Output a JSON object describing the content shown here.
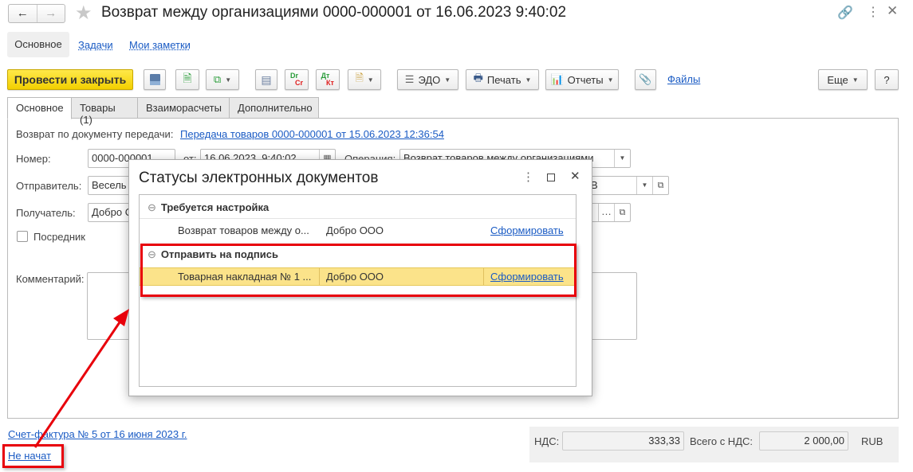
{
  "window": {
    "title": "Возврат между организациями 0000-000001 от 16.06.2023 9:40:02",
    "back_icon": "arrow-left",
    "forward_icon": "arrow-right",
    "star_icon": "star",
    "link_icon": "link",
    "more_icon": "more-vertical",
    "close_icon": "close"
  },
  "nav": {
    "items": [
      {
        "label": "Основное"
      },
      {
        "label": "Задачи"
      },
      {
        "label": "Мои заметки"
      }
    ]
  },
  "toolbar": {
    "post_close": "Провести и закрыть",
    "edo": "ЭДО",
    "print": "Печать",
    "reports": "Отчеты",
    "files": "Файлы",
    "more": "Еще",
    "help": "?",
    "dr": "Dr",
    "cr": "Cr",
    "dt": "Дт",
    "kt": "Кт"
  },
  "tabs": [
    {
      "label": "Основное"
    },
    {
      "label": "Товары (1)"
    },
    {
      "label": "Взаиморасчеты"
    },
    {
      "label": "Дополнительно"
    }
  ],
  "form": {
    "basis_label": "Возврат по документу передачи:",
    "basis_link": "Передача товаров 0000-000001 от 15.06.2023 12:36:54",
    "number_label": "Номер:",
    "number": "0000-000001",
    "date_label": "от:",
    "date": "16.06.2023  9:40:02",
    "operation_label": "Операция:",
    "operation": "Возврат товаров между организациями",
    "sender_label": "Отправитель:",
    "sender": "Весель",
    "sender_right": "В",
    "receiver_label": "Получатель:",
    "receiver": "Добро О",
    "intermediary_label": "Посредник",
    "intermediary_checked": false,
    "comment_label": "Комментарий:",
    "comment": ""
  },
  "dialog": {
    "title": "Статусы электронных документов",
    "groups": [
      {
        "name": "Требуется настройка",
        "rows": [
          {
            "doc": "Возврат товаров между о...",
            "org": "Добро ООО",
            "action": "Сформировать",
            "selected": false
          }
        ]
      },
      {
        "name": "Отправить на подпись",
        "rows": [
          {
            "doc": "Товарная накладная № 1 ...",
            "org": "Добро ООО",
            "action": "Сформировать",
            "selected": true
          }
        ]
      }
    ]
  },
  "footer": {
    "invoice_link": "Счет-фактура № 5 от 16 июня 2023 г.",
    "edo_status": "Не начат",
    "vat_label": "НДС:",
    "vat": "333,33",
    "total_label": "Всего с НДС:",
    "total": "2 000,00",
    "currency": "RUB"
  },
  "colors": {
    "accent_yellow": "#f5d800",
    "link": "#1a5bc4",
    "highlight": "#fbe38a",
    "annotation_red": "#e8000b"
  }
}
